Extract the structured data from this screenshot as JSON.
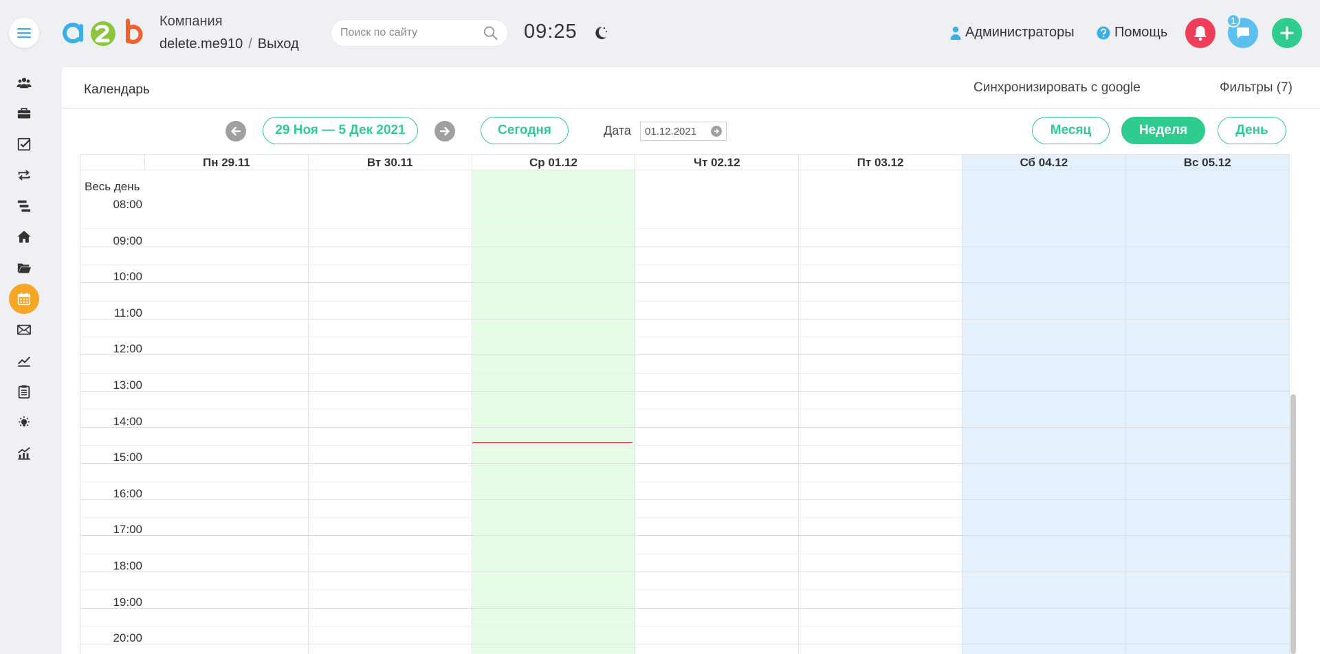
{
  "header": {
    "company_label": "Компания",
    "username": "delete.me910",
    "separator": "/",
    "logout_label": "Выход",
    "search_placeholder": "Поиск по сайту",
    "time": "09:25",
    "admins_label": "Администраторы",
    "help_label": "Помощь",
    "messages_badge": "1"
  },
  "calendar": {
    "title": "Календарь",
    "sync_label": "Синхронизировать с google",
    "filters_label": "Фильтры (7)",
    "range_label": "29 Ноя — 5 Дек 2021",
    "today_label": "Сегодня",
    "date_label": "Дата",
    "date_value": "01.12.2021",
    "view_month": "Месяц",
    "view_week": "Неделя",
    "view_day": "День",
    "active_view": "week",
    "all_day_label": "Весь день",
    "days": [
      {
        "label": "Пн 29.11",
        "kind": "normal"
      },
      {
        "label": "Вт 30.11",
        "kind": "normal"
      },
      {
        "label": "Ср 01.12",
        "kind": "today"
      },
      {
        "label": "Чт 02.12",
        "kind": "normal"
      },
      {
        "label": "Пт 03.12",
        "kind": "normal"
      },
      {
        "label": "Сб 04.12",
        "kind": "weekend"
      },
      {
        "label": "Вс 05.12",
        "kind": "weekend"
      }
    ],
    "hours": [
      "08:00",
      "09:00",
      "10:00",
      "11:00",
      "12:00",
      "13:00",
      "14:00",
      "15:00",
      "16:00",
      "17:00",
      "18:00",
      "19:00",
      "20:00"
    ],
    "current_time_marker": "14:25"
  },
  "colors": {
    "accent_green": "#2ecc8f",
    "today_bg": "#e6fce6",
    "weekend_bg": "#e4f0fc",
    "active_nav": "#f5a623",
    "bell_red": "#ef3e5c",
    "chat_blue": "#5bc0f0",
    "now_line": "#d0021b"
  },
  "sidebar": {
    "items": [
      {
        "icon": "users-icon"
      },
      {
        "icon": "briefcase-icon"
      },
      {
        "icon": "checkbox-icon"
      },
      {
        "icon": "repeat-icon"
      },
      {
        "icon": "stack-icon"
      },
      {
        "icon": "home-icon"
      },
      {
        "icon": "folder-icon"
      },
      {
        "icon": "calendar-icon",
        "active": true
      },
      {
        "icon": "mail-icon"
      },
      {
        "icon": "trend-icon"
      },
      {
        "icon": "clipboard-icon"
      },
      {
        "icon": "lightbulb-icon"
      },
      {
        "icon": "analytics-icon"
      }
    ]
  }
}
